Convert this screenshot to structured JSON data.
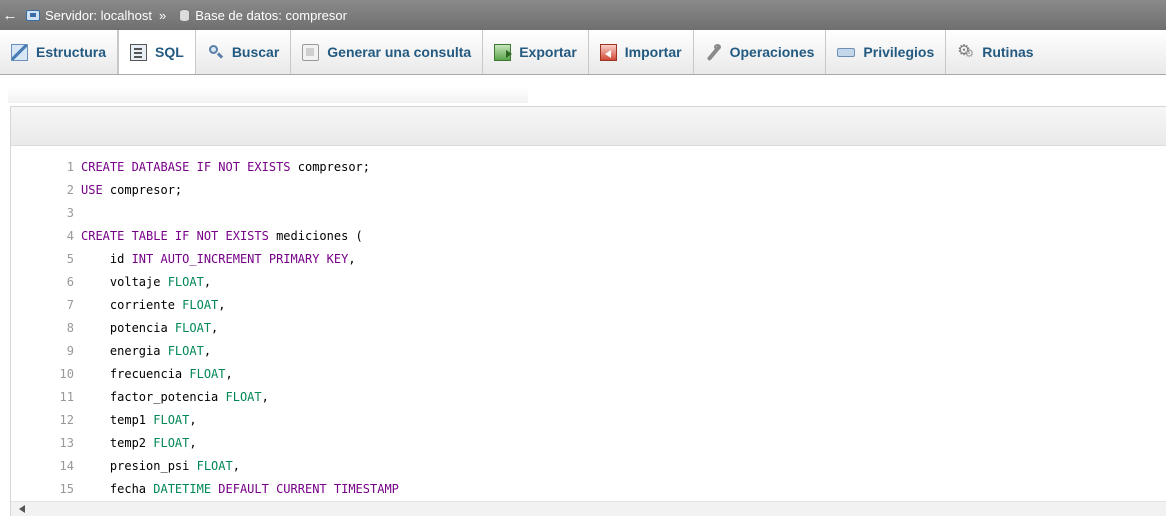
{
  "breadcrumb": {
    "back_symbol": "←",
    "server": "Servidor: localhost",
    "separator": "»",
    "database": "Base de datos: compresor"
  },
  "tabs": [
    {
      "label": "Estructura",
      "icon": "structure-icon",
      "active": false
    },
    {
      "label": "SQL",
      "icon": "sql-icon",
      "active": true
    },
    {
      "label": "Buscar",
      "icon": "search-icon",
      "active": false
    },
    {
      "label": "Generar una consulta",
      "icon": "query-icon",
      "active": false
    },
    {
      "label": "Exportar",
      "icon": "export-icon",
      "active": false
    },
    {
      "label": "Importar",
      "icon": "import-icon",
      "active": false
    },
    {
      "label": "Operaciones",
      "icon": "wrench-icon",
      "active": false
    },
    {
      "label": "Privilegios",
      "icon": "privileges-icon",
      "active": false
    },
    {
      "label": "Rutinas",
      "icon": "gears-icon",
      "active": false
    }
  ],
  "colors": {
    "keyword": "#770088",
    "type": "#008855",
    "line_number": "#999999",
    "tab_text": "#235a81"
  },
  "editor": {
    "lines": [
      {
        "n": "1",
        "tokens": [
          {
            "t": "CREATE DATABASE IF NOT EXISTS",
            "c": "kw"
          },
          {
            "t": " compresor;",
            "c": ""
          }
        ]
      },
      {
        "n": "2",
        "tokens": [
          {
            "t": "USE",
            "c": "kw"
          },
          {
            "t": " compresor;",
            "c": ""
          }
        ]
      },
      {
        "n": "3",
        "tokens": []
      },
      {
        "n": "4",
        "tokens": [
          {
            "t": "CREATE TABLE IF NOT EXISTS",
            "c": "kw"
          },
          {
            "t": " mediciones (",
            "c": ""
          }
        ]
      },
      {
        "n": "5",
        "tokens": [
          {
            "t": "    id ",
            "c": ""
          },
          {
            "t": "INT AUTO_INCREMENT PRIMARY KEY",
            "c": "kw"
          },
          {
            "t": ",",
            "c": ""
          }
        ]
      },
      {
        "n": "6",
        "tokens": [
          {
            "t": "    voltaje ",
            "c": ""
          },
          {
            "t": "FLOAT",
            "c": "ty"
          },
          {
            "t": ",",
            "c": ""
          }
        ]
      },
      {
        "n": "7",
        "tokens": [
          {
            "t": "    corriente ",
            "c": ""
          },
          {
            "t": "FLOAT",
            "c": "ty"
          },
          {
            "t": ",",
            "c": ""
          }
        ]
      },
      {
        "n": "8",
        "tokens": [
          {
            "t": "    potencia ",
            "c": ""
          },
          {
            "t": "FLOAT",
            "c": "ty"
          },
          {
            "t": ",",
            "c": ""
          }
        ]
      },
      {
        "n": "9",
        "tokens": [
          {
            "t": "    energia ",
            "c": ""
          },
          {
            "t": "FLOAT",
            "c": "ty"
          },
          {
            "t": ",",
            "c": ""
          }
        ]
      },
      {
        "n": "10",
        "tokens": [
          {
            "t": "    frecuencia ",
            "c": ""
          },
          {
            "t": "FLOAT",
            "c": "ty"
          },
          {
            "t": ",",
            "c": ""
          }
        ]
      },
      {
        "n": "11",
        "tokens": [
          {
            "t": "    factor_potencia ",
            "c": ""
          },
          {
            "t": "FLOAT",
            "c": "ty"
          },
          {
            "t": ",",
            "c": ""
          }
        ]
      },
      {
        "n": "12",
        "tokens": [
          {
            "t": "    temp1 ",
            "c": ""
          },
          {
            "t": "FLOAT",
            "c": "ty"
          },
          {
            "t": ",",
            "c": ""
          }
        ]
      },
      {
        "n": "13",
        "tokens": [
          {
            "t": "    temp2 ",
            "c": ""
          },
          {
            "t": "FLOAT",
            "c": "ty"
          },
          {
            "t": ",",
            "c": ""
          }
        ]
      },
      {
        "n": "14",
        "tokens": [
          {
            "t": "    presion_psi ",
            "c": ""
          },
          {
            "t": "FLOAT",
            "c": "ty"
          },
          {
            "t": ",",
            "c": ""
          }
        ]
      },
      {
        "n": "15",
        "tokens": [
          {
            "t": "    fecha ",
            "c": ""
          },
          {
            "t": "DATETIME",
            "c": "ty"
          },
          {
            "t": " DEFAULT CURRENT_TIMESTAMP",
            "c": "kw"
          }
        ]
      }
    ]
  }
}
